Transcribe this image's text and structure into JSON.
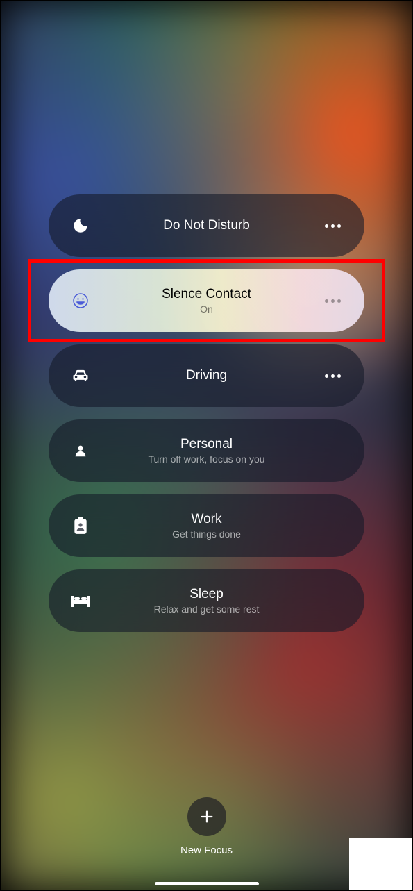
{
  "focus_modes": [
    {
      "id": "dnd",
      "title": "Do Not Disturb",
      "subtitle": "",
      "icon": "moon",
      "style": "dark",
      "show_more": true
    },
    {
      "id": "silence-contact",
      "title": "Slence Contact",
      "subtitle": "On",
      "icon": "emoji-grin",
      "style": "light",
      "show_more": true,
      "highlighted": true
    },
    {
      "id": "driving",
      "title": "Driving",
      "subtitle": "",
      "icon": "car",
      "style": "dark",
      "show_more": true
    },
    {
      "id": "personal",
      "title": "Personal",
      "subtitle": "Turn off work, focus on you",
      "icon": "person",
      "style": "dark",
      "show_more": false
    },
    {
      "id": "work",
      "title": "Work",
      "subtitle": "Get things done",
      "icon": "badge",
      "style": "dark",
      "show_more": false
    },
    {
      "id": "sleep",
      "title": "Sleep",
      "subtitle": "Relax and get some rest",
      "icon": "bed",
      "style": "dark",
      "show_more": false
    }
  ],
  "new_focus": {
    "label": "New Focus"
  }
}
